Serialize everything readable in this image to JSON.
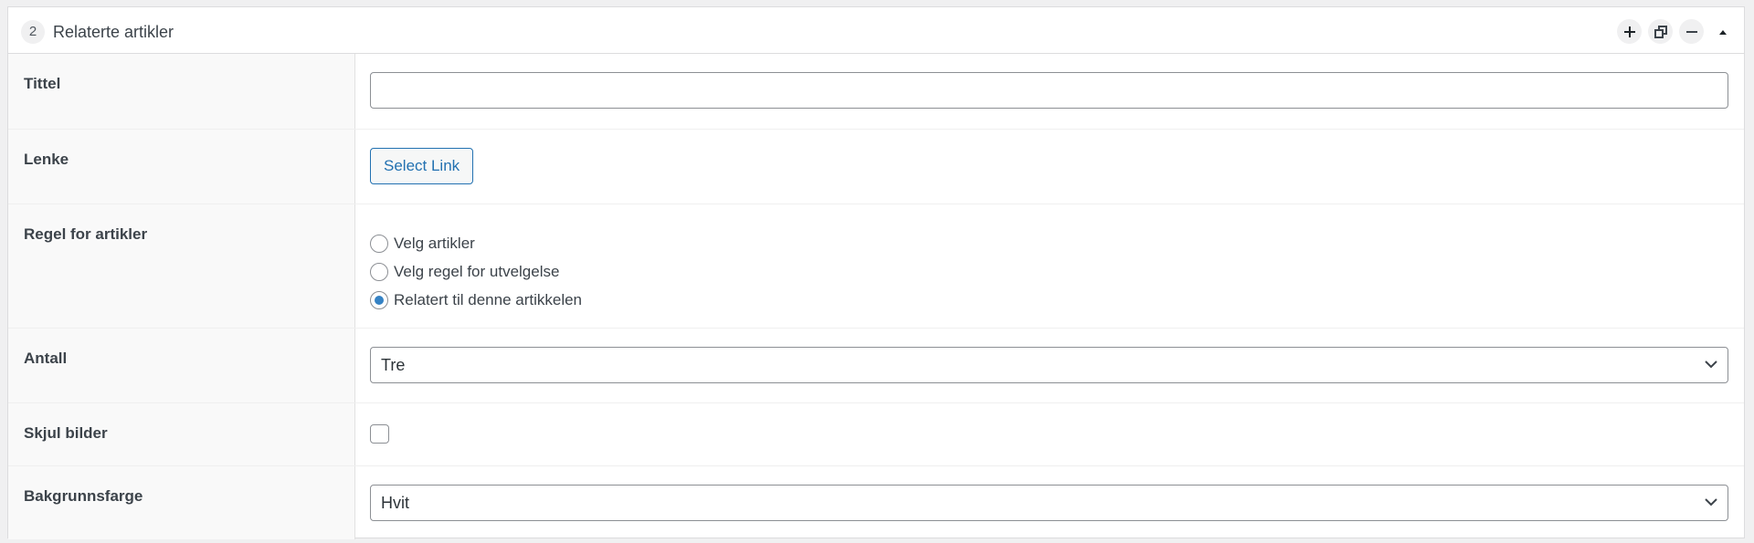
{
  "panel": {
    "order_number": "2",
    "title": "Relaterte artikler",
    "header_actions": [
      {
        "name": "add",
        "icon": "plus-icon"
      },
      {
        "name": "duplicate",
        "icon": "duplicate-icon"
      },
      {
        "name": "remove",
        "icon": "minus-icon"
      },
      {
        "name": "collapse",
        "icon": "caret-up-icon"
      }
    ]
  },
  "fields": {
    "tittel": {
      "label": "Tittel",
      "value": "",
      "placeholder": ""
    },
    "lenke": {
      "label": "Lenke",
      "button_label": "Select Link"
    },
    "regel": {
      "label": "Regel for artikler",
      "options": [
        {
          "label": "Velg artikler",
          "checked": false
        },
        {
          "label": "Velg regel for utvelgelse",
          "checked": false
        },
        {
          "label": "Relatert til denne artikkelen",
          "checked": true
        }
      ]
    },
    "antall": {
      "label": "Antall",
      "selected": "Tre"
    },
    "skjul_bilder": {
      "label": "Skjul bilder",
      "checked": false
    },
    "bakgrunnsfarge": {
      "label": "Bakgrunnsfarge",
      "selected": "Hvit"
    }
  },
  "colors": {
    "accent": "#2271b1",
    "radio_checked": "#3582c4",
    "page_background": "#f0f0f1",
    "label_background": "#f9f9f9"
  }
}
